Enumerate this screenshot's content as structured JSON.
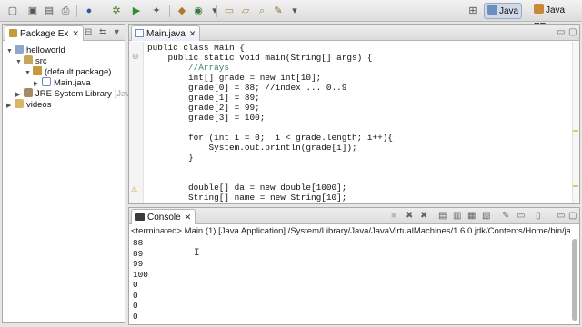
{
  "perspectives": {
    "java": "Java",
    "javaee": "Java EE"
  },
  "package_explorer": {
    "tab_label": "Package Ex",
    "tree": [
      {
        "label": "helloworld",
        "dim": ""
      },
      {
        "label": "src",
        "dim": ""
      },
      {
        "label": "(default package)",
        "dim": ""
      },
      {
        "label": "Main.java",
        "dim": ""
      },
      {
        "label": "JRE System Library",
        "dim": " [Java"
      },
      {
        "label": "videos",
        "dim": ""
      }
    ]
  },
  "editor": {
    "tab_label": "Main.java",
    "lines": [
      "public class Main {",
      "    public static void main(String[] args) {",
      "        //Arrays",
      "        int[] grade = new int[10];",
      "        grade[0] = 88; //index ... 0..9",
      "        grade[1] = 89;",
      "        grade[2] = 99;",
      "        grade[3] = 100;",
      "",
      "        for (int i = 0;  i < grade.length; i++){",
      "            System.out.println(grade[i]);",
      "        }",
      "",
      "",
      "        double[] da = new double[1000];",
      "        String[] name = new String[10];"
    ]
  },
  "console": {
    "tab_label": "Console",
    "status": "<terminated> Main (1) [Java Application] /System/Library/Java/JavaVirtualMachines/1.6.0.jdk/Contents/Home/bin/java (De",
    "output": [
      "88",
      "89",
      "99",
      "100",
      "0",
      "0",
      "0",
      "0"
    ]
  }
}
